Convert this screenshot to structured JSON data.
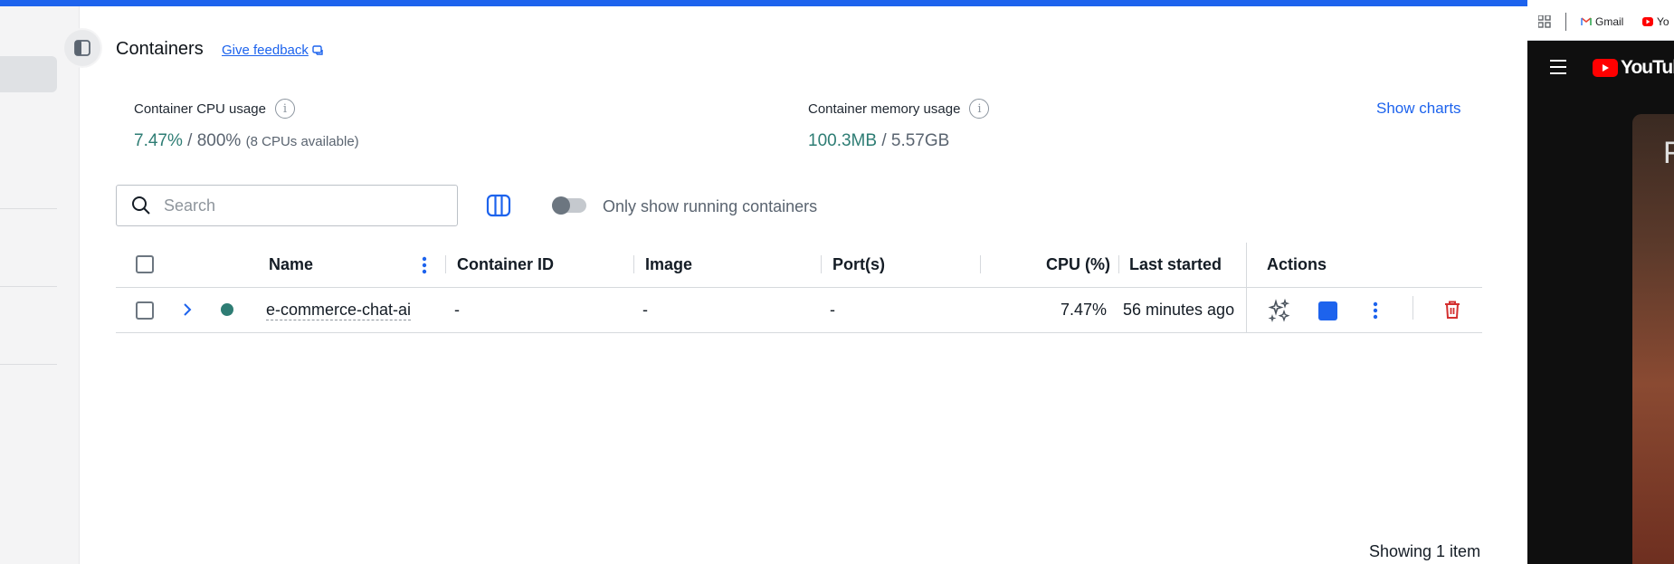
{
  "header": {
    "title": "Containers",
    "feedback_label": "Give feedback"
  },
  "stats": {
    "cpu": {
      "label": "Container CPU usage",
      "value": "7.47%",
      "separator": " / ",
      "total": "800%",
      "note": "(8 CPUs available)"
    },
    "memory": {
      "label": "Container memory usage",
      "value": "100.3MB",
      "separator": " / ",
      "total": "5.57GB"
    },
    "show_charts_label": "Show charts"
  },
  "toolbar": {
    "search_placeholder": "Search",
    "running_toggle_label": "Only show running containers",
    "running_toggle_on": false
  },
  "table": {
    "columns": [
      "Name",
      "Container ID",
      "Image",
      "Port(s)",
      "CPU (%)",
      "Last started",
      "Actions"
    ],
    "rows": [
      {
        "status": "running",
        "name": "e-commerce-chat-ai",
        "container_id": "-",
        "image": "-",
        "ports": "-",
        "cpu": "7.47%",
        "last_started": "56 minutes ago"
      }
    ],
    "footer": "Showing 1 item"
  },
  "browser": {
    "bookmarks": [
      "Gmail",
      "Yo"
    ],
    "yt_logo_text": "YouTube",
    "thumb_letter": "F"
  },
  "colors": {
    "accent": "#1d63ed",
    "status_running": "#2e7d74",
    "danger": "#d32f2f"
  }
}
